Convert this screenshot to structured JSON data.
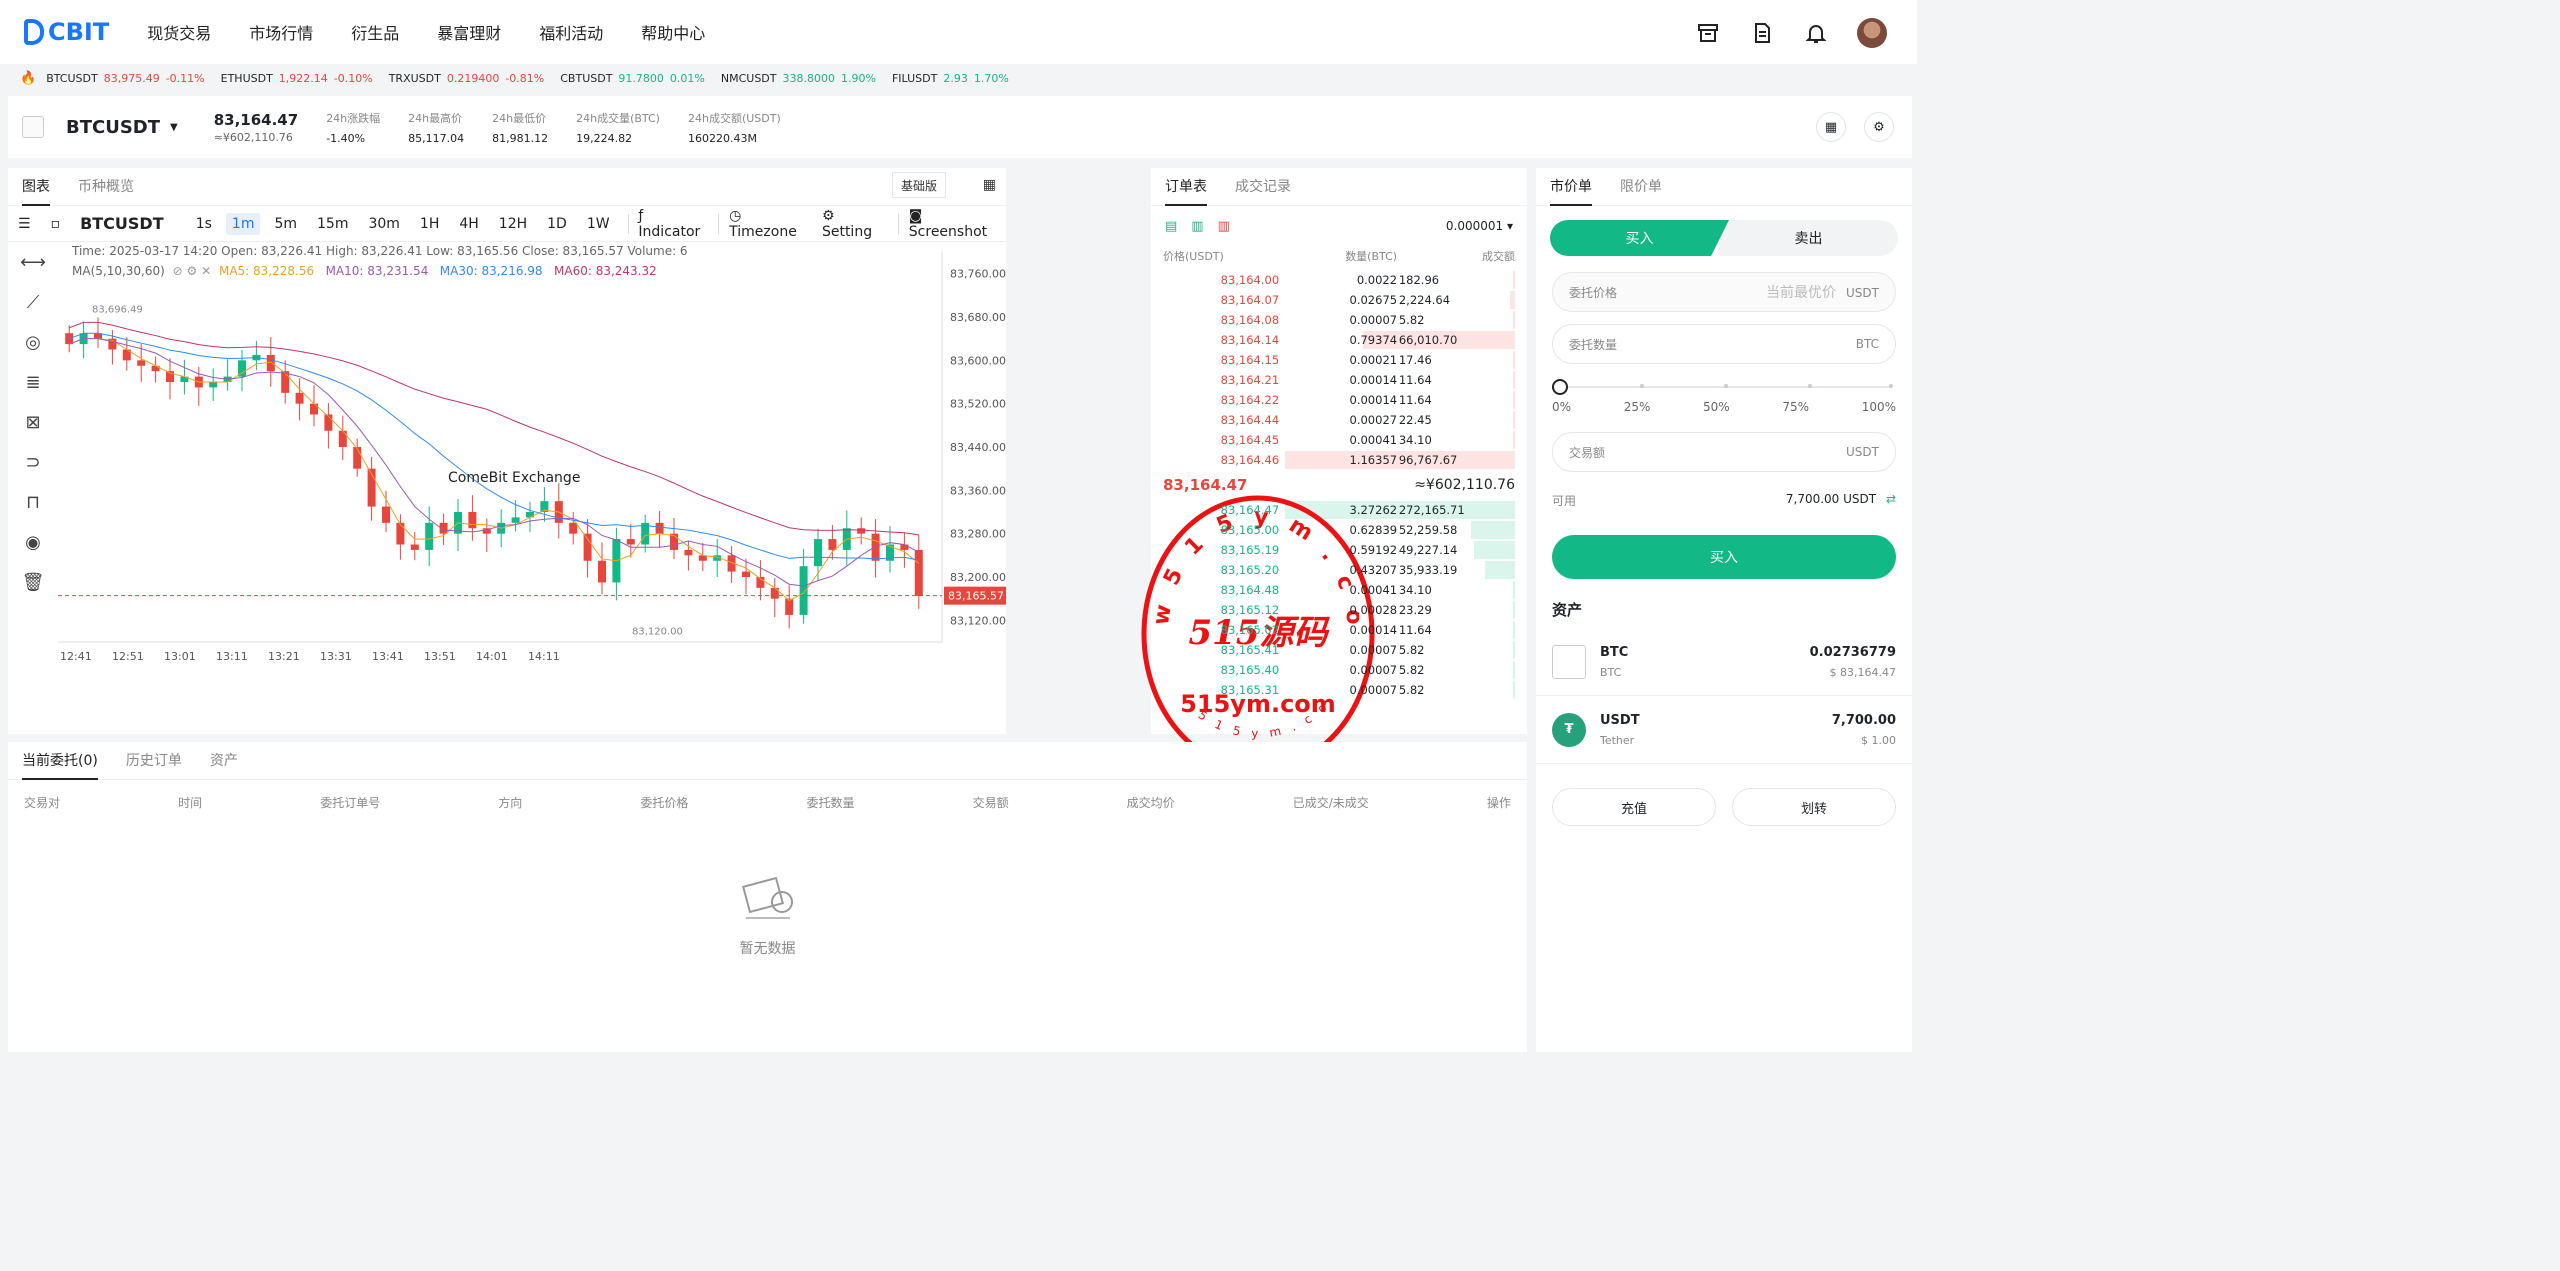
{
  "nav": {
    "logo": "CBIT",
    "items": [
      "现货交易",
      "市场行情",
      "衍生品",
      "暴富理财",
      "福利活动",
      "帮助中心"
    ]
  },
  "ticker": [
    {
      "sym": "BTCUSDT",
      "price": "83,975.49",
      "chg": "-0.11%",
      "dir": "down"
    },
    {
      "sym": "ETHUSDT",
      "price": "1,922.14",
      "chg": "-0.10%",
      "dir": "down"
    },
    {
      "sym": "TRXUSDT",
      "price": "0.219400",
      "chg": "-0.81%",
      "dir": "down"
    },
    {
      "sym": "CBTUSDT",
      "price": "91.7800",
      "chg": "0.01%",
      "dir": "up"
    },
    {
      "sym": "NMCUSDT",
      "price": "338.8000",
      "chg": "1.90%",
      "dir": "up"
    },
    {
      "sym": "FILUSDT",
      "price": "2.93",
      "chg": "1.70%",
      "dir": "up"
    }
  ],
  "pair": {
    "name": "BTCUSDT",
    "price": "83,164.47",
    "price_cny": "≈¥602,110.76",
    "stats": [
      {
        "label": "24h涨跌幅",
        "value": "-1.40%"
      },
      {
        "label": "24h最高价",
        "value": "85,117.04"
      },
      {
        "label": "24h最低价",
        "value": "81,981.12"
      },
      {
        "label": "24h成交量(BTC)",
        "value": "19,224.82"
      },
      {
        "label": "24h成交额(USDT)",
        "value": "160220.43M"
      }
    ]
  },
  "chart": {
    "tabs": [
      "图表",
      "币种概览"
    ],
    "basic_btn": "基础版",
    "symbol": "BTCUSDT",
    "intervals": [
      "1s",
      "1m",
      "5m",
      "15m",
      "30m",
      "1H",
      "4H",
      "12H",
      "1D",
      "1W"
    ],
    "active_interval": "1m",
    "tools": [
      "Indicator",
      "Timezone",
      "Setting",
      "Screenshot"
    ],
    "legend_ohlc": "Time: 2025-03-17 14:20   Open: 83,226.41   High: 83,226.41   Low: 83,165.56   Close: 83,165.57   Volume: 6",
    "legend_ma_name": "MA(5,10,30,60)",
    "ma5": "MA5: 83,228.56",
    "ma10": "MA10: 83,231.54",
    "ma30": "MA30: 83,216.98",
    "ma60": "MA60: 83,243.32",
    "watermark": "ComeBit Exchange",
    "high_label": "83,696.49",
    "low_label": "83,120.00",
    "last_price": "83,165.57"
  },
  "chart_data": {
    "type": "candlestick",
    "y_ticks": [
      "83,760.00",
      "83,680.00",
      "83,600.00",
      "83,520.00",
      "83,440.00",
      "83,360.00",
      "83,280.00",
      "83,200.00",
      "83,120.00"
    ],
    "ylim": [
      83080,
      83800
    ],
    "x_ticks": [
      "12:41",
      "12:51",
      "13:01",
      "13:11",
      "13:21",
      "13:31",
      "13:41",
      "13:51",
      "14:01",
      "14:11"
    ],
    "close": [
      83630,
      83650,
      83640,
      83620,
      83600,
      83590,
      83580,
      83560,
      83570,
      83550,
      83560,
      83570,
      83600,
      83610,
      83580,
      83540,
      83520,
      83500,
      83470,
      83440,
      83400,
      83330,
      83300,
      83260,
      83250,
      83300,
      83280,
      83320,
      83290,
      83280,
      83300,
      83310,
      83320,
      83340,
      83300,
      83280,
      83230,
      83190,
      83270,
      83260,
      83300,
      83280,
      83250,
      83240,
      83230,
      83240,
      83210,
      83200,
      83180,
      83160,
      83130,
      83220,
      83270,
      83250,
      83290,
      83280,
      83230,
      83260,
      83250,
      83165
    ]
  },
  "orderbook": {
    "tabs": [
      "订单表",
      "成交记录"
    ],
    "precision": "0.000001",
    "headers": [
      "价格(USDT)",
      "数量(BTC)",
      "成交额"
    ],
    "asks": [
      [
        "83,164.00",
        "0.0022",
        "182.96"
      ],
      [
        "83,164.07",
        "0.02675",
        "2,224.64"
      ],
      [
        "83,164.08",
        "0.00007",
        "5.82"
      ],
      [
        "83,164.14",
        "0.79374",
        "66,010.70"
      ],
      [
        "83,164.15",
        "0.00021",
        "17.46"
      ],
      [
        "83,164.21",
        "0.00014",
        "11.64"
      ],
      [
        "83,164.22",
        "0.00014",
        "11.64"
      ],
      [
        "83,164.44",
        "0.00027",
        "22.45"
      ],
      [
        "83,164.45",
        "0.00041",
        "34.10"
      ],
      [
        "83,164.46",
        "1.16357",
        "96,767.67"
      ]
    ],
    "ask_depth": [
      0.01,
      0.02,
      0.01,
      0.66,
      0.01,
      0.01,
      0.01,
      0.01,
      0.01,
      1.0
    ],
    "mid_price": "83,164.47",
    "mid_cny": "≈¥602,110.76",
    "bids": [
      [
        "83,164.47",
        "3.27262",
        "272,165.71"
      ],
      [
        "83,165.00",
        "0.62839",
        "52,259.58"
      ],
      [
        "83,165.19",
        "0.59192",
        "49,227.14"
      ],
      [
        "83,165.20",
        "0.43207",
        "35,933.19"
      ],
      [
        "83,164.48",
        "0.00041",
        "34.10"
      ],
      [
        "83,165.12",
        "0.00028",
        "23.29"
      ],
      [
        "83,165.02",
        "0.00014",
        "11.64"
      ],
      [
        "83,165.41",
        "0.00007",
        "5.82"
      ],
      [
        "83,165.40",
        "0.00007",
        "5.82"
      ],
      [
        "83,165.31",
        "0.00007",
        "5.82"
      ]
    ],
    "bid_depth": [
      1.0,
      0.19,
      0.18,
      0.13,
      0.01,
      0.01,
      0.01,
      0.01,
      0.01,
      0.01
    ]
  },
  "stamp": {
    "top": "w 5 1 5 y m . c o m",
    "main": "515源码",
    "url": "515ym.com",
    "bottom": "5 1 5 y m . c o m"
  },
  "orders": {
    "tabs": [
      "当前委托(0)",
      "历史订单",
      "资产"
    ],
    "headers": [
      "交易对",
      "时间",
      "委托订单号",
      "方向",
      "委托价格",
      "委托数量",
      "交易额",
      "成交均价",
      "已成交/未成交",
      "操作"
    ],
    "empty": "暂无数据"
  },
  "trade": {
    "tabs": [
      "市价单",
      "限价单"
    ],
    "buy": "买入",
    "sell": "卖出",
    "price_label": "委托价格",
    "price_placeholder": "当前最优价",
    "price_unit": "USDT",
    "qty_label": "委托数量",
    "qty_unit": "BTC",
    "pcts": [
      "0%",
      "25%",
      "50%",
      "75%",
      "100%"
    ],
    "slider_value": 0,
    "amount_label": "交易额",
    "amount_unit": "USDT",
    "avail_label": "可用",
    "avail_value": "7,700.00 USDT",
    "buy_btn": "买入"
  },
  "assets": {
    "title": "资产",
    "items": [
      {
        "sym": "BTC",
        "name": "BTC",
        "amount": "0.02736779",
        "value": "$ 83,164.47"
      },
      {
        "sym": "USDT",
        "name": "Tether",
        "amount": "7,700.00",
        "value": "$ 1.00"
      }
    ],
    "deposit": "充值",
    "transfer": "划转"
  }
}
